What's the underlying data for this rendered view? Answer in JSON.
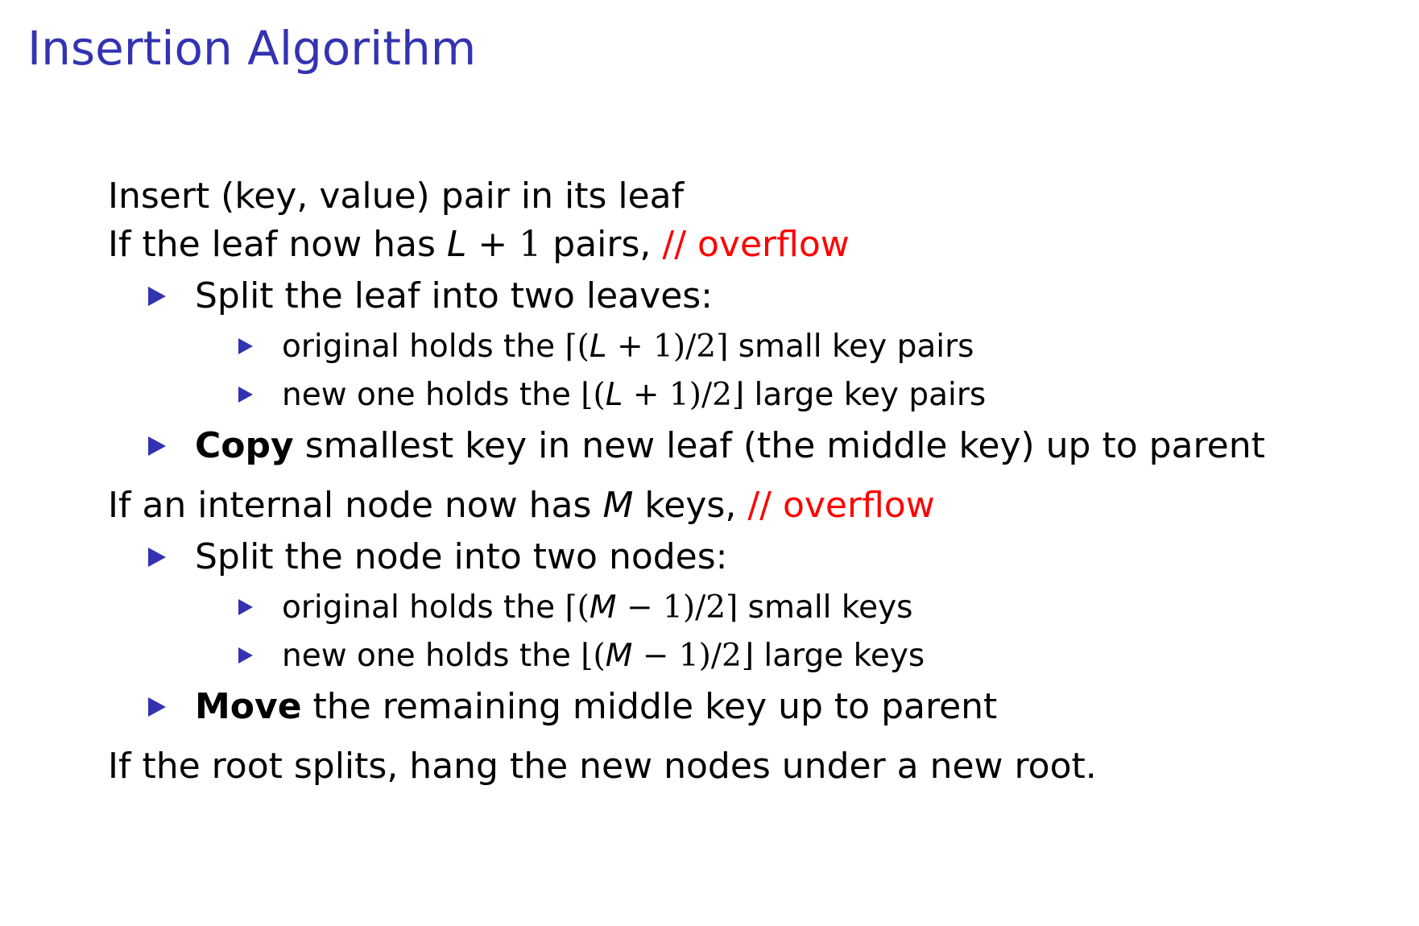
{
  "slide": {
    "title": "Insertion Algorithm"
  },
  "lines": {
    "insert_text": "Insert (key, value) pair in its leaf",
    "leaf_if_prefix": "If the leaf now has ",
    "leaf_var": "L",
    "leaf_expr": " + 1",
    "leaf_if_suffix": " pairs, ",
    "leaf_comment": "// overflow",
    "split_leaf_text": "Split the leaf into two leaves:",
    "leaf_orig_prefix": "original holds the ",
    "leaf_orig_open": "⌈(",
    "leaf_orig_var": "L",
    "leaf_orig_expr": " + 1)/2⌉",
    "leaf_orig_suffix": " small key pairs",
    "leaf_new_prefix": "new one holds the ",
    "leaf_new_open": "⌊(",
    "leaf_new_var": "L",
    "leaf_new_expr": " + 1)/2⌋",
    "leaf_new_suffix": " large key pairs",
    "copy_bold": "Copy",
    "copy_rest": " smallest key in new leaf (the middle key) up to parent",
    "internal_if_prefix": "If an internal node now has ",
    "internal_var": "M",
    "internal_if_suffix": " keys, ",
    "internal_comment": "// overflow",
    "split_node_text": "Split the node into two nodes:",
    "node_orig_prefix": "original holds the ",
    "node_orig_open": "⌈(",
    "node_orig_var": "M",
    "node_orig_expr": " − 1)/2⌉",
    "node_orig_suffix": " small keys",
    "node_new_prefix": "new one holds the ",
    "node_new_open": "⌊(",
    "node_new_var": "M",
    "node_new_expr": " − 1)/2⌋",
    "node_new_suffix": " large keys",
    "move_bold": "Move",
    "move_rest": " the remaining middle key up to parent",
    "root_text": "If the root splits, hang the new nodes under a new root."
  },
  "colors": {
    "accent": "#3333b2",
    "alert": "#ff0000",
    "text": "#000000"
  },
  "icons": {
    "level1_bullet": "triangle-bullet-icon",
    "level2_bullet": "small-triangle-bullet-icon"
  }
}
